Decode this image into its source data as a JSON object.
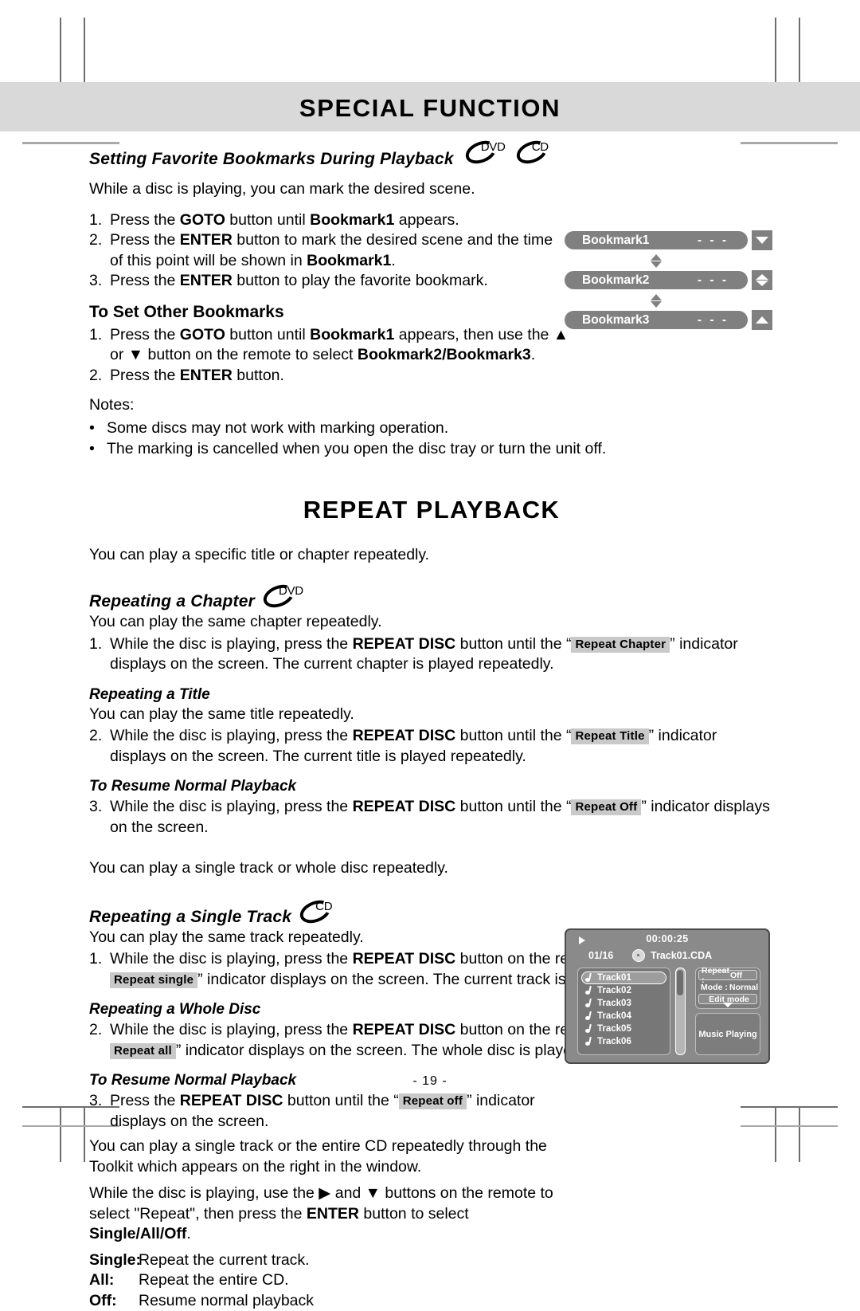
{
  "page": {
    "title": "SPECIAL FUNCTION",
    "number": "- 19 -"
  },
  "bookmark_section": {
    "heading": "Setting Favorite Bookmarks During Playback",
    "disc_tags": [
      "DVD",
      "CD"
    ],
    "intro": "While a disc is playing, you can mark the desired scene.",
    "steps": [
      {
        "marker": "1.",
        "parts": [
          {
            "t": "Press the ",
            "b": false
          },
          {
            "t": "GOTO",
            "b": true
          },
          {
            "t": " button until ",
            "b": false
          },
          {
            "t": "Bookmark1",
            "b": true
          },
          {
            "t": " appears.",
            "b": false
          }
        ]
      },
      {
        "marker": "2.",
        "parts": [
          {
            "t": "Press the ",
            "b": false
          },
          {
            "t": "ENTER",
            "b": true
          },
          {
            "t": " button to mark the desired scene and the time of this point will be shown in ",
            "b": false
          },
          {
            "t": "Bookmark1",
            "b": true
          },
          {
            "t": ".",
            "b": false
          }
        ]
      },
      {
        "marker": "3.",
        "parts": [
          {
            "t": "Press the ",
            "b": false
          },
          {
            "t": "ENTER",
            "b": true
          },
          {
            "t": " button to play the favorite bookmark.",
            "b": false
          }
        ]
      }
    ],
    "other_heading": "To Set Other Bookmarks",
    "other_steps": [
      {
        "marker": "1.",
        "parts": [
          {
            "t": "Press the ",
            "b": false
          },
          {
            "t": "GOTO",
            "b": true
          },
          {
            "t": " button until ",
            "b": false
          },
          {
            "t": "Bookmark1",
            "b": true
          },
          {
            "t": " appears, then use the ▲ or ▼ button on the remote to select ",
            "b": false
          },
          {
            "t": "Bookmark2/Bookmark3",
            "b": true
          },
          {
            "t": ".",
            "b": false
          }
        ]
      },
      {
        "marker": "2.",
        "parts": [
          {
            "t": "Press the ",
            "b": false
          },
          {
            "t": "ENTER",
            "b": true
          },
          {
            "t": " button.",
            "b": false
          }
        ]
      }
    ],
    "notes_label": "Notes:",
    "notes": [
      "Some discs may not work with marking operation.",
      "The marking is cancelled when you open the disc tray or turn the unit off."
    ]
  },
  "bookmark_widget": {
    "rows": [
      {
        "name": "Bookmark1",
        "value": "- - -",
        "arrow": "down"
      },
      {
        "name": "Bookmark2",
        "value": "- - -",
        "arrow": "both"
      },
      {
        "name": "Bookmark3",
        "value": "- - -",
        "arrow": "up"
      }
    ]
  },
  "repeat_section": {
    "title": "REPEAT PLAYBACK",
    "intro": "You can play a specific title or chapter repeatedly.",
    "chapter": {
      "heading": "Repeating a Chapter",
      "disc_tag": "DVD",
      "desc": "You can play the same chapter repeatedly.",
      "step_marker": "1.",
      "pre": "While the disc is playing, press the ",
      "btn": "REPEAT DISC",
      "mid": " button until the “",
      "badge": "Repeat  Chapter",
      "post": "” indicator displays on the screen. The current chapter is played repeatedly."
    },
    "title_sub": {
      "heading": "Repeating a Title",
      "desc": "You can play the same title repeatedly.",
      "step_marker": "2.",
      "pre": "While the disc is playing, press the ",
      "btn": "REPEAT DISC",
      "mid": " button until the “",
      "badge": "Repeat  Title",
      "post": "” indicator displays on the screen. The current title is played repeatedly."
    },
    "resume_dvd": {
      "heading": "To Resume Normal Playback",
      "step_marker": "3.",
      "pre": "While the disc is playing, press the ",
      "btn": "REPEAT DISC",
      "mid": " button until the “",
      "badge": "Repeat  Off",
      "post": "” indicator displays on the screen."
    },
    "cd_intro": "You can play a single track or whole disc repeatedly.",
    "single_track": {
      "heading": "Repeating a Single Track",
      "disc_tag": "CD",
      "desc": "You can play the same track repeatedly.",
      "step_marker": "1.",
      "pre": "While the disc is playing, press the ",
      "btn": "REPEAT DISC",
      "mid": " button on the remote control until the “",
      "badge": "Repeat  single",
      "post": "” indicator displays on the screen. The current track is played repeatedly."
    },
    "whole_disc": {
      "heading": "Repeating a Whole Disc",
      "step_marker": "2.",
      "pre": "While the disc is playing, press the ",
      "btn": "REPEAT DISC",
      "mid": " button on the remote control until the “",
      "badge": "Repeat  all",
      "post": "” indicator displays on the screen. The whole disc is played repeatedly."
    },
    "resume_cd": {
      "heading": "To Resume Normal Playback",
      "step_marker": "3.",
      "pre": "Press the ",
      "btn": "REPEAT DISC",
      "mid": " button until the “",
      "badge": "Repeat  off",
      "post": "” indicator displays on the screen."
    },
    "toolkit_para": "You can play a single track or the entire CD repeatedly through the Toolkit which appears on the right in the window.",
    "usage_parts": [
      {
        "t": "While the disc is playing, use the ▶ and ▼ buttons on the remote to select \"Repeat\", then press the ",
        "b": false
      },
      {
        "t": "ENTER",
        "b": true
      },
      {
        "t": " button to select ",
        "b": false
      },
      {
        "t": "Single/All/Off",
        "b": true
      },
      {
        "t": ".",
        "b": false
      }
    ],
    "options": [
      {
        "key": "Single:",
        "desc": "Repeat the current track."
      },
      {
        "key": "All:",
        "desc": "Repeat the entire CD."
      },
      {
        "key": "Off:",
        "desc": "Resume normal playback"
      }
    ]
  },
  "osd": {
    "time": "00:00:25",
    "index": "01/16",
    "filename": "Track01.CDA",
    "tracks": [
      "Track01",
      "Track02",
      "Track03",
      "Track04",
      "Track05",
      "Track06"
    ],
    "selected_track": "Track01",
    "toolkit": {
      "repeat_key": "Repeat :",
      "repeat_value": "Off",
      "mode_key": "Mode   :",
      "mode_value": "Normal",
      "edit_mode": "Edit mode"
    },
    "status": "Music Playing"
  }
}
